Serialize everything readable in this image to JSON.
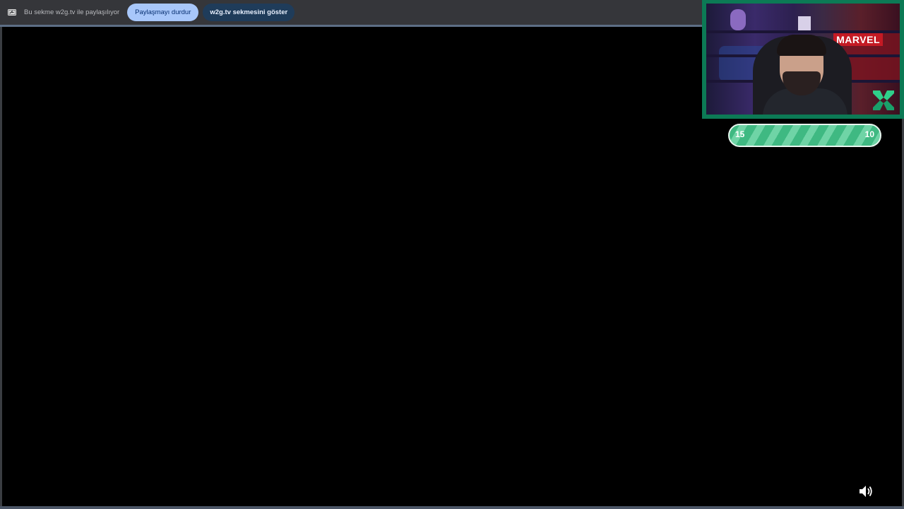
{
  "share_bar": {
    "icon": "screen-share-icon",
    "status_text": "Bu sekme w2g.tv ile paylaşılıyor",
    "stop_button_label": "Paylaşmayı durdur",
    "show_tab_button_label": "w2g.tv sekmesini göster"
  },
  "overlay": {
    "banner_text": "MARVEL",
    "logo_icon": "k-logo-icon",
    "score_left": "15",
    "score_right": "10"
  },
  "player": {
    "volume_icon": "volume-icon"
  },
  "colors": {
    "infobar_bg": "#35363a",
    "stop_button_bg": "#a8c7fa",
    "show_button_bg": "#1f3c5a",
    "score_green": "#3fb982",
    "cam_border": "#0c7a55"
  }
}
